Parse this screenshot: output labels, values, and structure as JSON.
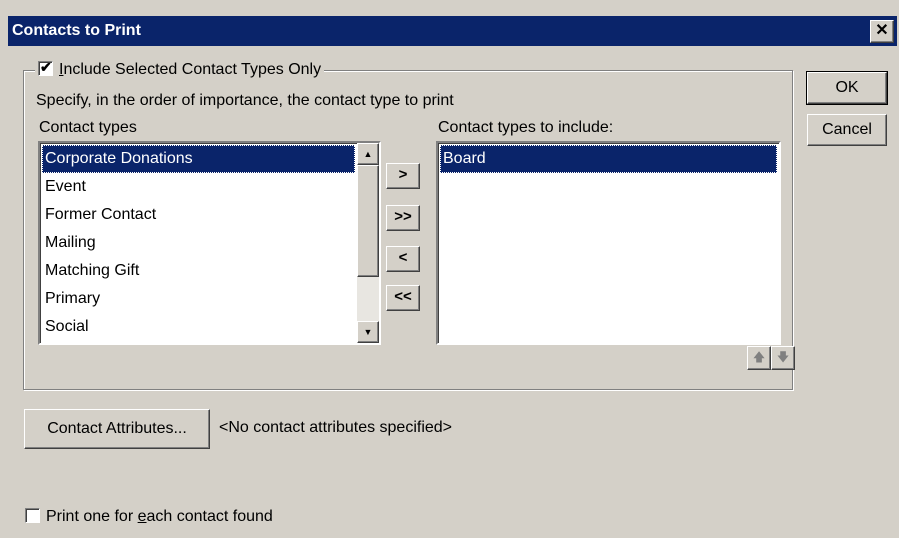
{
  "window": {
    "title": "Contacts to Print",
    "close_glyph": "✕"
  },
  "group": {
    "include_checkbox": {
      "checked": true,
      "mark": "✔",
      "label_prefix": "",
      "label_mnemonic": "I",
      "label_rest": "nclude Selected Contact Types Only"
    },
    "instructions": "Specify, in the order of importance, the contact type to print",
    "left_list": {
      "header": "Contact types",
      "items": [
        "Corporate Donations",
        "Event",
        "Former Contact",
        "Mailing",
        "Matching Gift",
        "Primary",
        "Social"
      ],
      "selected_index": 0,
      "scroll_up_icon": "▲",
      "scroll_down_icon": "▼"
    },
    "move_buttons": {
      "add_one": ">",
      "add_all": ">>",
      "remove_one": "<",
      "remove_all": "<<"
    },
    "right_list": {
      "header": "Contact types to include:",
      "items": [
        "Board"
      ],
      "selected_index": 0
    },
    "order_buttons": {
      "up_icon": "🡅",
      "down_icon": "🡇"
    }
  },
  "buttons": {
    "ok": "OK",
    "cancel": "Cancel",
    "contact_attributes": "Contact Attributes..."
  },
  "attributes_status": "<No contact attributes specified>",
  "print_each": {
    "checked": false,
    "label_prefix": "Print one for ",
    "label_mnemonic": "e",
    "label_rest": "ach contact found"
  }
}
